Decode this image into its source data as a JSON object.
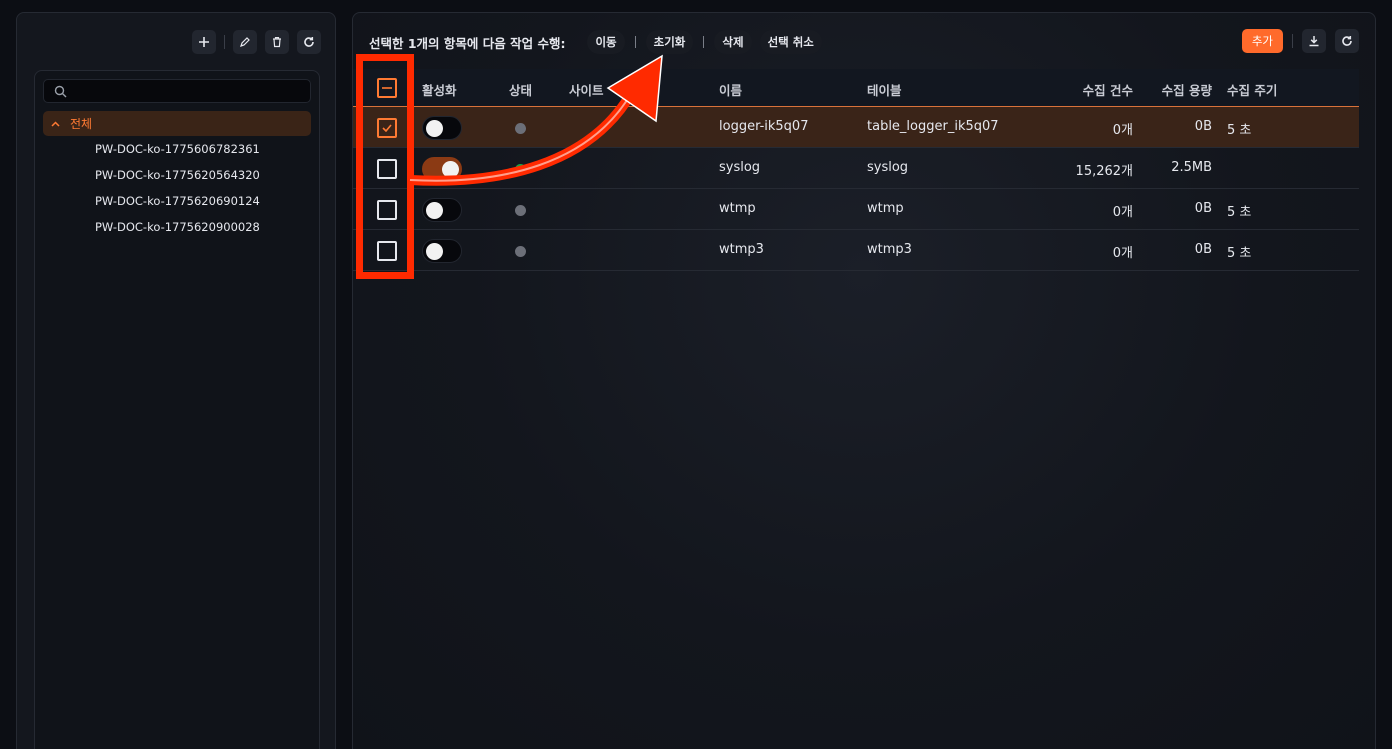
{
  "left_toolbar": {
    "icons": [
      "plus-icon",
      "pencil-icon",
      "trash-icon",
      "refresh-icon"
    ]
  },
  "tree": {
    "search_placeholder": "",
    "root_label": "전체",
    "children": [
      "PW-DOC-ko-1775606782361",
      "PW-DOC-ko-1775620564320",
      "PW-DOC-ko-1775620690124",
      "PW-DOC-ko-1775620900028"
    ]
  },
  "action_bar": {
    "prompt": "선택한 1개의 항목에 다음 작업 수행:",
    "move": "이동",
    "reset": "초기화",
    "delete": "삭제",
    "deselect": "선택 취소"
  },
  "toolbar": {
    "add": "추가",
    "icons": [
      "download-icon",
      "refresh-icon"
    ]
  },
  "table": {
    "headers": {
      "enabled": "활성화",
      "status": "상태",
      "site": "사이트",
      "name": "이름",
      "table": "테이블",
      "count": "수집 건수",
      "size": "수집 용량",
      "interval": "수집 주기"
    },
    "rows": [
      {
        "checked": true,
        "enabled": false,
        "status": "gray",
        "site": "",
        "name": "logger-ik5q07",
        "table": "table_logger_ik5q07",
        "count": "0개",
        "size": "0B",
        "interval": "5 초"
      },
      {
        "checked": false,
        "enabled": true,
        "status": "green",
        "site": "",
        "name": "syslog",
        "table": "syslog",
        "count": "15,262개",
        "size": "2.5MB",
        "interval": ""
      },
      {
        "checked": false,
        "enabled": false,
        "status": "gray",
        "site": "",
        "name": "wtmp",
        "table": "wtmp",
        "count": "0개",
        "size": "0B",
        "interval": "5 초"
      },
      {
        "checked": false,
        "enabled": false,
        "status": "gray",
        "site": "",
        "name": "wtmp3",
        "table": "wtmp3",
        "count": "0개",
        "size": "0B",
        "interval": "5 초"
      }
    ]
  },
  "colors": {
    "accent": "#ff6a2b",
    "selected_row": "#3a2418",
    "annotation": "#ff2a00",
    "status_active": "#16a34a",
    "status_inactive": "#6c6f78"
  }
}
